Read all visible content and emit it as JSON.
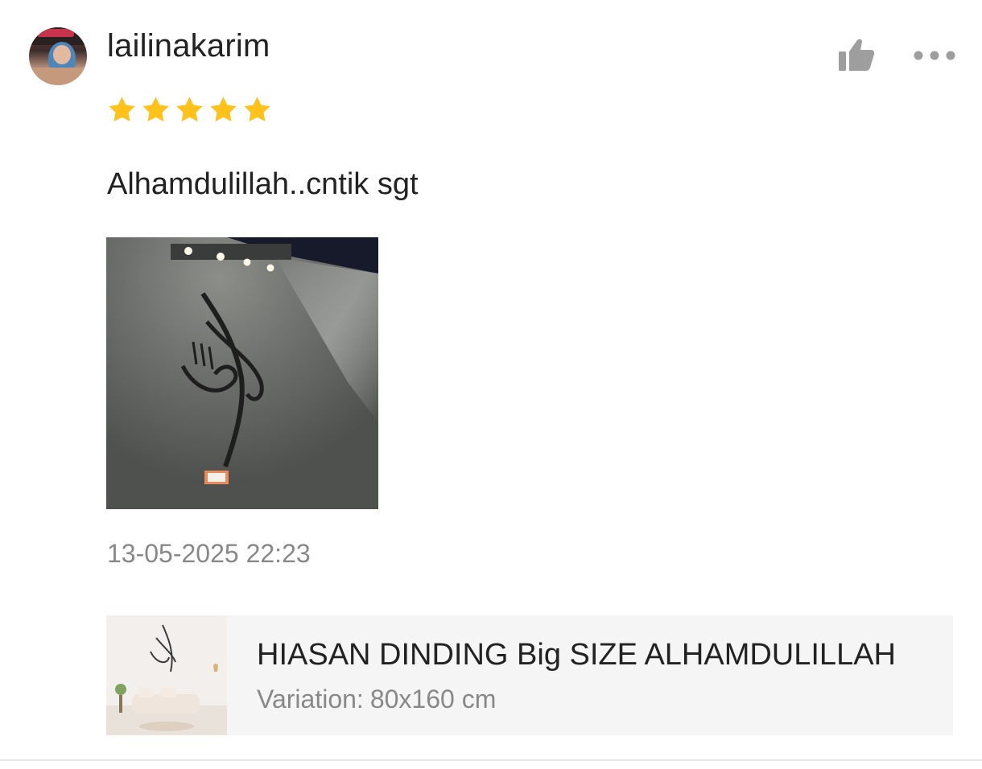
{
  "review": {
    "username": "lailinakarim",
    "rating": 5,
    "rating_max": 5,
    "comment": "Alhamdulillah..cntik sgt",
    "timestamp": "13-05-2025 22:23"
  },
  "actions": {
    "like_icon": "thumbs-up-icon",
    "more_icon": "more-horizontal-icon"
  },
  "product": {
    "name": "HIASAN DINDING Big SIZE ALHAMDULILLAH",
    "variation_label": "Variation:",
    "variation_value": "80x160 cm"
  },
  "colors": {
    "star": "#FFC21A",
    "icon_gray": "#9e9e9e",
    "product_bg": "#f5f5f5",
    "text_primary": "#222222",
    "text_secondary": "#888888"
  }
}
